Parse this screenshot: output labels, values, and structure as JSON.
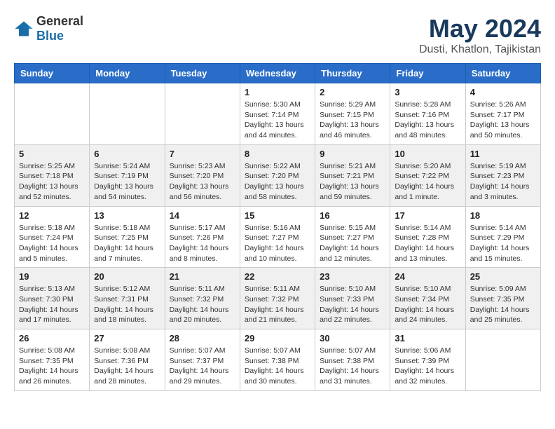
{
  "header": {
    "logo": {
      "text_general": "General",
      "text_blue": "Blue"
    },
    "title": "May 2024",
    "location": "Dusti, Khatlon, Tajikistan"
  },
  "calendar": {
    "weekdays": [
      "Sunday",
      "Monday",
      "Tuesday",
      "Wednesday",
      "Thursday",
      "Friday",
      "Saturday"
    ],
    "weeks": [
      {
        "days": [
          {
            "num": "",
            "info": ""
          },
          {
            "num": "",
            "info": ""
          },
          {
            "num": "",
            "info": ""
          },
          {
            "num": "1",
            "info": "Sunrise: 5:30 AM\nSunset: 7:14 PM\nDaylight: 13 hours\nand 44 minutes."
          },
          {
            "num": "2",
            "info": "Sunrise: 5:29 AM\nSunset: 7:15 PM\nDaylight: 13 hours\nand 46 minutes."
          },
          {
            "num": "3",
            "info": "Sunrise: 5:28 AM\nSunset: 7:16 PM\nDaylight: 13 hours\nand 48 minutes."
          },
          {
            "num": "4",
            "info": "Sunrise: 5:26 AM\nSunset: 7:17 PM\nDaylight: 13 hours\nand 50 minutes."
          }
        ]
      },
      {
        "days": [
          {
            "num": "5",
            "info": "Sunrise: 5:25 AM\nSunset: 7:18 PM\nDaylight: 13 hours\nand 52 minutes."
          },
          {
            "num": "6",
            "info": "Sunrise: 5:24 AM\nSunset: 7:19 PM\nDaylight: 13 hours\nand 54 minutes."
          },
          {
            "num": "7",
            "info": "Sunrise: 5:23 AM\nSunset: 7:20 PM\nDaylight: 13 hours\nand 56 minutes."
          },
          {
            "num": "8",
            "info": "Sunrise: 5:22 AM\nSunset: 7:20 PM\nDaylight: 13 hours\nand 58 minutes."
          },
          {
            "num": "9",
            "info": "Sunrise: 5:21 AM\nSunset: 7:21 PM\nDaylight: 13 hours\nand 59 minutes."
          },
          {
            "num": "10",
            "info": "Sunrise: 5:20 AM\nSunset: 7:22 PM\nDaylight: 14 hours\nand 1 minute."
          },
          {
            "num": "11",
            "info": "Sunrise: 5:19 AM\nSunset: 7:23 PM\nDaylight: 14 hours\nand 3 minutes."
          }
        ]
      },
      {
        "days": [
          {
            "num": "12",
            "info": "Sunrise: 5:18 AM\nSunset: 7:24 PM\nDaylight: 14 hours\nand 5 minutes."
          },
          {
            "num": "13",
            "info": "Sunrise: 5:18 AM\nSunset: 7:25 PM\nDaylight: 14 hours\nand 7 minutes."
          },
          {
            "num": "14",
            "info": "Sunrise: 5:17 AM\nSunset: 7:26 PM\nDaylight: 14 hours\nand 8 minutes."
          },
          {
            "num": "15",
            "info": "Sunrise: 5:16 AM\nSunset: 7:27 PM\nDaylight: 14 hours\nand 10 minutes."
          },
          {
            "num": "16",
            "info": "Sunrise: 5:15 AM\nSunset: 7:27 PM\nDaylight: 14 hours\nand 12 minutes."
          },
          {
            "num": "17",
            "info": "Sunrise: 5:14 AM\nSunset: 7:28 PM\nDaylight: 14 hours\nand 13 minutes."
          },
          {
            "num": "18",
            "info": "Sunrise: 5:14 AM\nSunset: 7:29 PM\nDaylight: 14 hours\nand 15 minutes."
          }
        ]
      },
      {
        "days": [
          {
            "num": "19",
            "info": "Sunrise: 5:13 AM\nSunset: 7:30 PM\nDaylight: 14 hours\nand 17 minutes."
          },
          {
            "num": "20",
            "info": "Sunrise: 5:12 AM\nSunset: 7:31 PM\nDaylight: 14 hours\nand 18 minutes."
          },
          {
            "num": "21",
            "info": "Sunrise: 5:11 AM\nSunset: 7:32 PM\nDaylight: 14 hours\nand 20 minutes."
          },
          {
            "num": "22",
            "info": "Sunrise: 5:11 AM\nSunset: 7:32 PM\nDaylight: 14 hours\nand 21 minutes."
          },
          {
            "num": "23",
            "info": "Sunrise: 5:10 AM\nSunset: 7:33 PM\nDaylight: 14 hours\nand 22 minutes."
          },
          {
            "num": "24",
            "info": "Sunrise: 5:10 AM\nSunset: 7:34 PM\nDaylight: 14 hours\nand 24 minutes."
          },
          {
            "num": "25",
            "info": "Sunrise: 5:09 AM\nSunset: 7:35 PM\nDaylight: 14 hours\nand 25 minutes."
          }
        ]
      },
      {
        "days": [
          {
            "num": "26",
            "info": "Sunrise: 5:08 AM\nSunset: 7:35 PM\nDaylight: 14 hours\nand 26 minutes."
          },
          {
            "num": "27",
            "info": "Sunrise: 5:08 AM\nSunset: 7:36 PM\nDaylight: 14 hours\nand 28 minutes."
          },
          {
            "num": "28",
            "info": "Sunrise: 5:07 AM\nSunset: 7:37 PM\nDaylight: 14 hours\nand 29 minutes."
          },
          {
            "num": "29",
            "info": "Sunrise: 5:07 AM\nSunset: 7:38 PM\nDaylight: 14 hours\nand 30 minutes."
          },
          {
            "num": "30",
            "info": "Sunrise: 5:07 AM\nSunset: 7:38 PM\nDaylight: 14 hours\nand 31 minutes."
          },
          {
            "num": "31",
            "info": "Sunrise: 5:06 AM\nSunset: 7:39 PM\nDaylight: 14 hours\nand 32 minutes."
          },
          {
            "num": "",
            "info": ""
          }
        ]
      }
    ]
  }
}
